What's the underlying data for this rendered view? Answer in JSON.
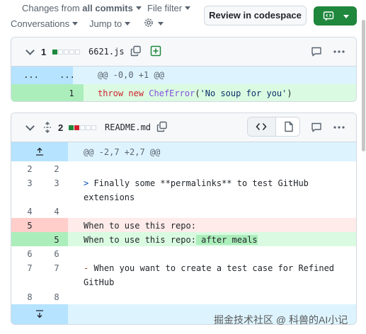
{
  "toolbar": {
    "changes_prefix": "Changes from",
    "changes_value": "all commits",
    "file_filter": "File filter",
    "conversations": "Conversations",
    "jump_to": "Jump to",
    "review_button": "Review in codespace"
  },
  "files": [
    {
      "count": "1",
      "name": "6621.js",
      "hunk": "@@ -0,0 +1 @@",
      "hunk_left": "...",
      "hunk_right": "...",
      "lines": [
        {
          "old": "",
          "new": "1",
          "code": "throw new ChefError('No soup for you')",
          "type": "add"
        }
      ]
    },
    {
      "count": "2",
      "name": "README.md",
      "hunk": "@@ -2,7 +2,7 @@",
      "lines": [
        {
          "old": "2",
          "new": "2",
          "code": "",
          "type": "ctx"
        },
        {
          "old": "3",
          "new": "3",
          "code": "> Finally some **permalinks** to test GitHub",
          "code2": "extensions",
          "type": "ctx"
        },
        {
          "old": "4",
          "new": "4",
          "code": "",
          "type": "ctx"
        },
        {
          "old": "5",
          "new": "",
          "code": "When to use this repo:",
          "type": "del"
        },
        {
          "old": "",
          "new": "5",
          "code": "When to use this repo:",
          "code_added": " after meals",
          "type": "add"
        },
        {
          "old": "6",
          "new": "6",
          "code": "",
          "type": "ctx"
        },
        {
          "old": "7",
          "new": "7",
          "code": "- When you want to create a test case for Refined",
          "code2": "GitHub",
          "type": "ctx"
        },
        {
          "old": "8",
          "new": "8",
          "code": "",
          "type": "ctx"
        }
      ]
    }
  ],
  "watermark": "掘金技术社区 @ 科兽的AI小记",
  "colors": {
    "add_bg": "#dafbe1",
    "add_num_bg": "#aceebb",
    "del_bg": "#ffebe9",
    "del_num_bg": "#ffcecb",
    "hunk_bg": "#ddf4ff",
    "hunk_num_bg": "#b6e3ff",
    "green_button": "#1f883d"
  }
}
